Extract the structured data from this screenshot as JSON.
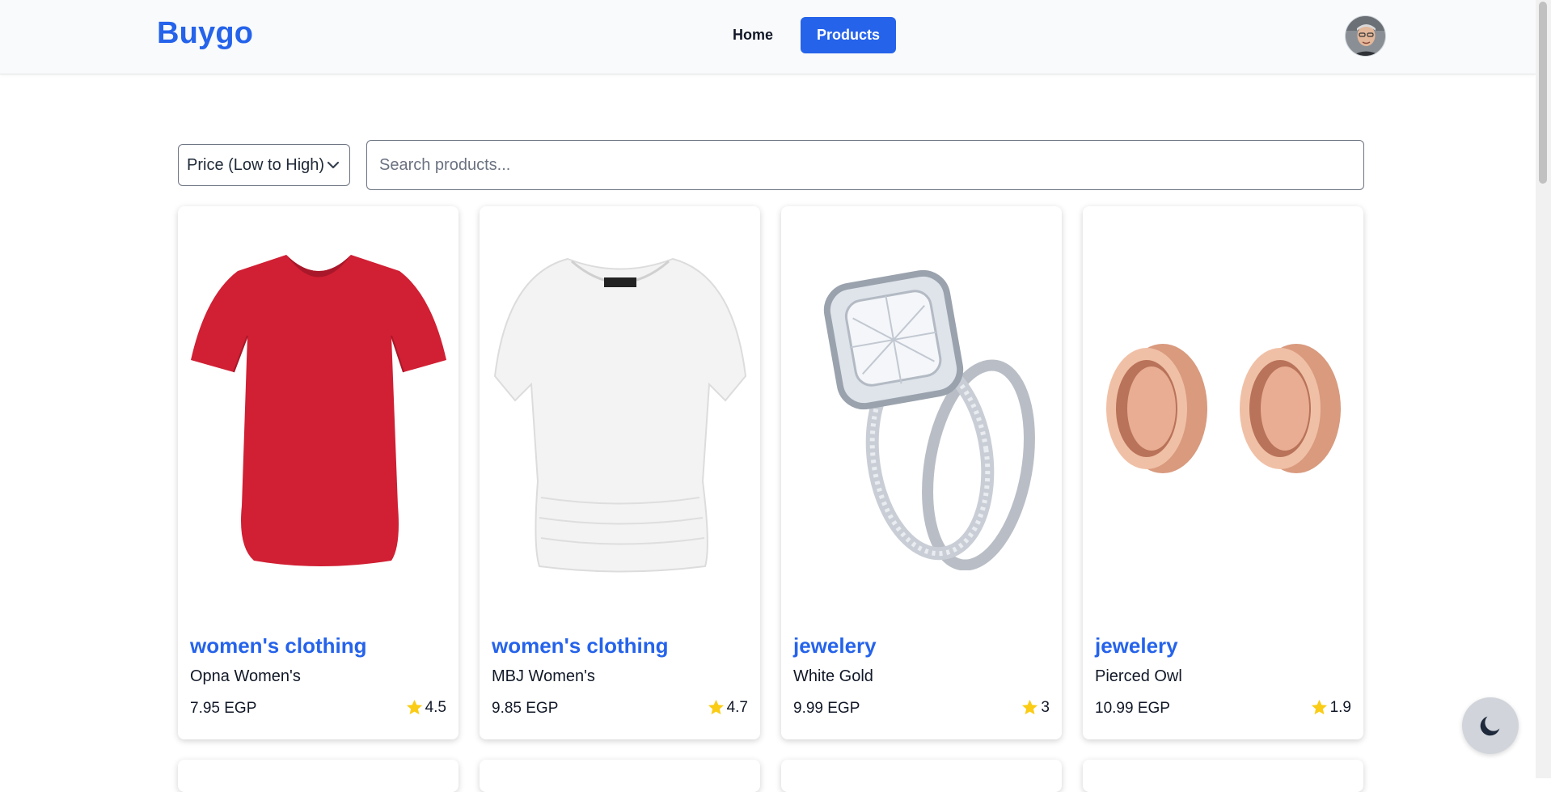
{
  "header": {
    "brand": "Buygo",
    "nav": [
      {
        "label": "Home",
        "active": false
      },
      {
        "label": "Products",
        "active": true
      }
    ]
  },
  "controls": {
    "sort_value": "Price (Low to High)",
    "search_placeholder": "Search products..."
  },
  "products": [
    {
      "category": "women's clothing",
      "title": "Opna Women's",
      "price": "7.95 EGP",
      "rating": "4.5",
      "image": "red-tshirt-icon"
    },
    {
      "category": "women's clothing",
      "title": "MBJ Women's",
      "price": "9.85 EGP",
      "rating": "4.7",
      "image": "white-top-icon"
    },
    {
      "category": "jewelery",
      "title": "White Gold",
      "price": "9.99 EGP",
      "rating": "3",
      "image": "diamond-ring-icon"
    },
    {
      "category": "jewelery",
      "title": "Pierced Owl",
      "price": "10.99 EGP",
      "rating": "1.9",
      "image": "rose-gold-tunnels-icon"
    }
  ],
  "colors": {
    "accent": "#2563eb",
    "star": "#facc15"
  }
}
